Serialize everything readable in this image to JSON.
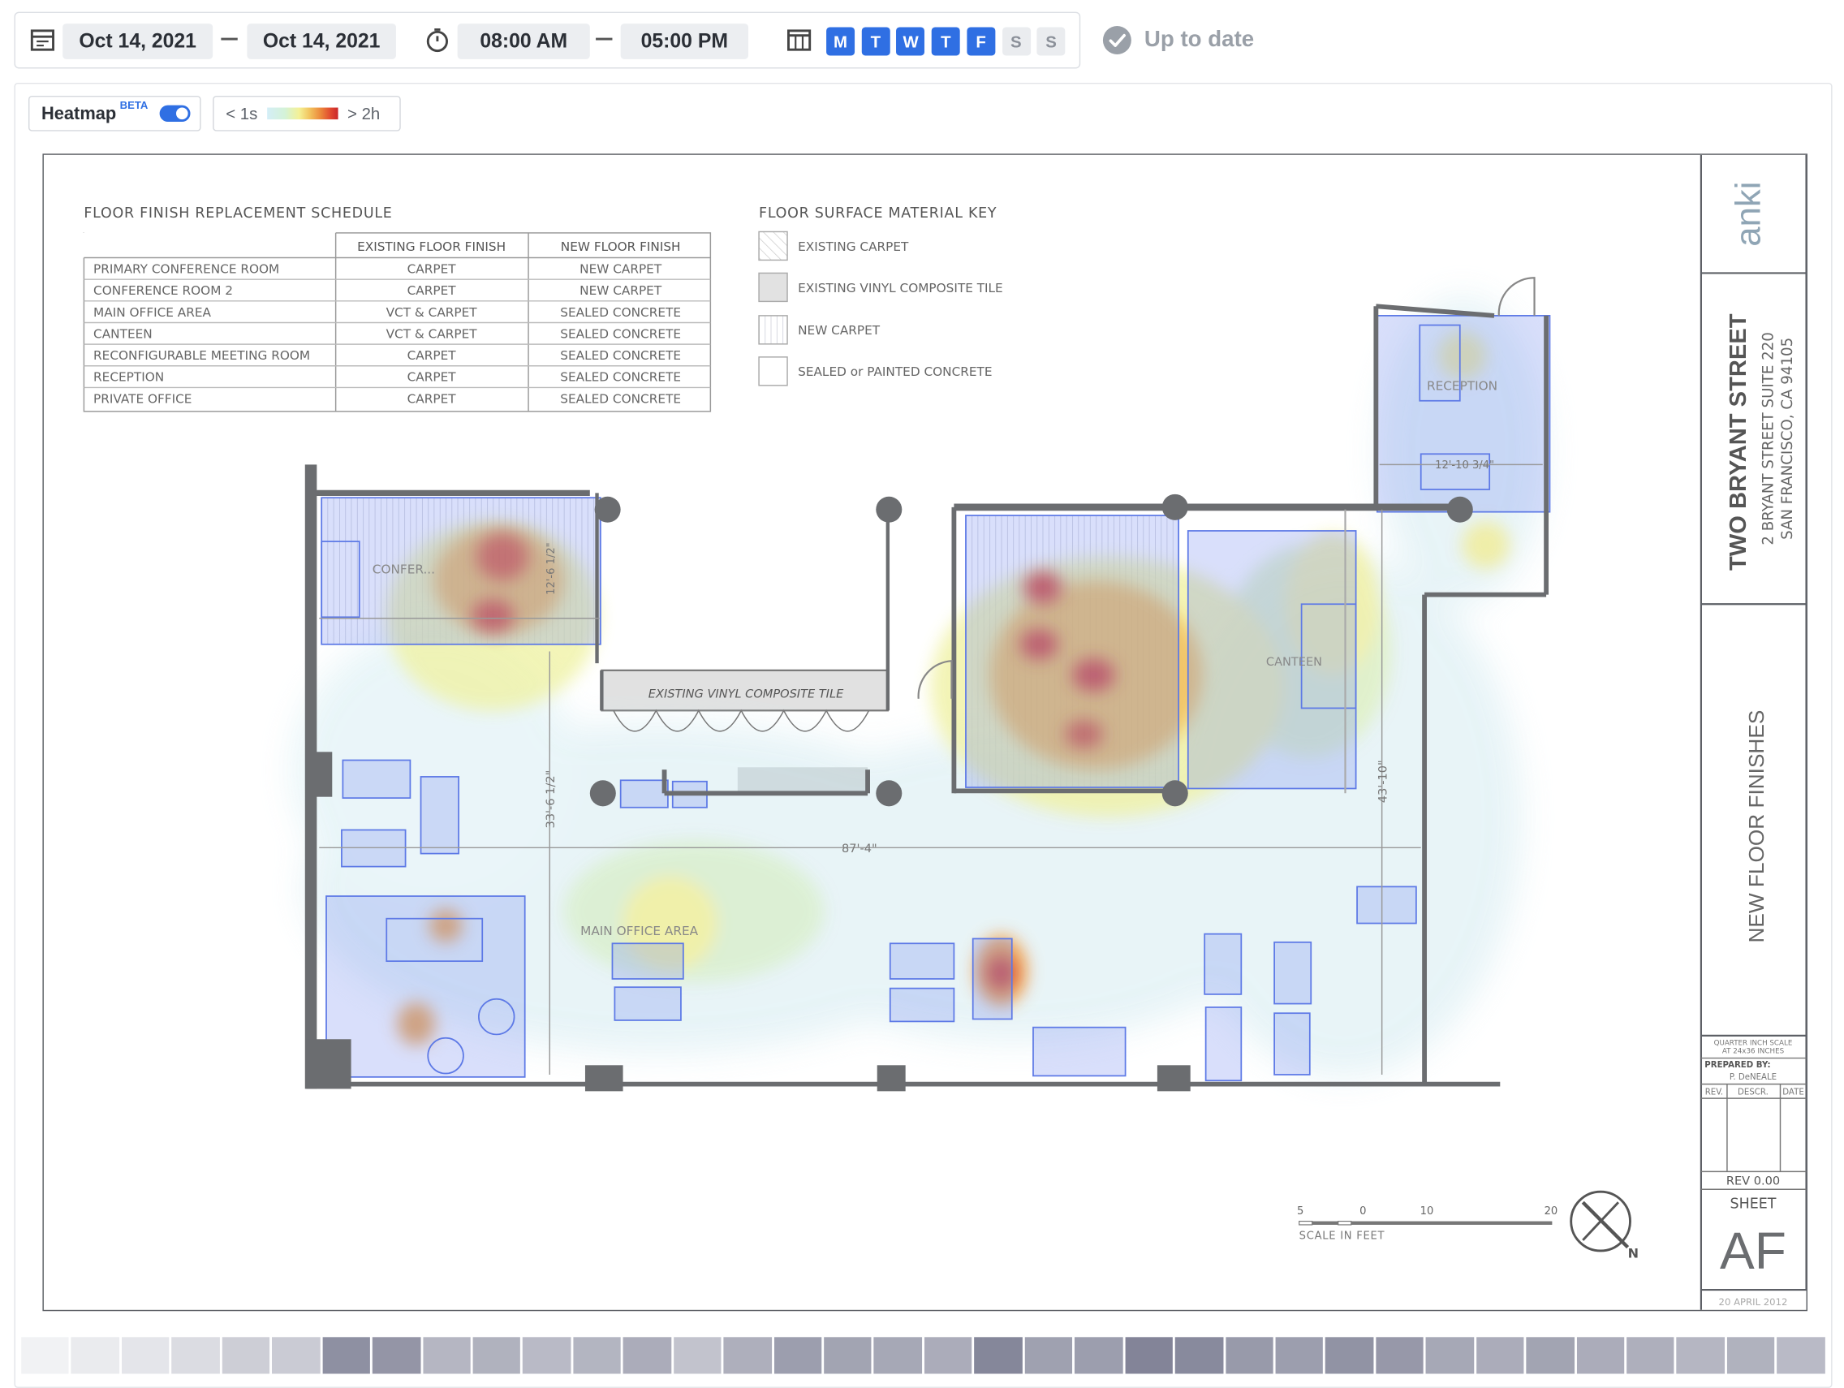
{
  "toolbar": {
    "date_start": "Oct 14, 2021",
    "date_end": "Oct 14, 2021",
    "time_start": "08:00 AM",
    "time_end": "05:00 PM",
    "days": [
      {
        "label": "M",
        "active": true
      },
      {
        "label": "T",
        "active": true
      },
      {
        "label": "W",
        "active": true
      },
      {
        "label": "T",
        "active": true
      },
      {
        "label": "F",
        "active": true
      },
      {
        "label": "S",
        "active": false
      },
      {
        "label": "S",
        "active": false
      }
    ],
    "status": "Up to date"
  },
  "heatmap_controls": {
    "label": "Heatmap",
    "badge": "BETA",
    "enabled": true,
    "legend_min": "< 1s",
    "legend_max": "> 2h"
  },
  "schedule": {
    "title": "FLOOR FINISH REPLACEMENT SCHEDULE",
    "headers": [
      "",
      "EXISTING FLOOR FINISH",
      "NEW FLOOR FINISH"
    ],
    "rows": [
      [
        "PRIMARY CONFERENCE ROOM",
        "CARPET",
        "NEW CARPET"
      ],
      [
        "CONFERENCE ROOM 2",
        "CARPET",
        "NEW CARPET"
      ],
      [
        "MAIN OFFICE AREA",
        "VCT & CARPET",
        "SEALED CONCRETE"
      ],
      [
        "CANTEEN",
        "VCT & CARPET",
        "SEALED CONCRETE"
      ],
      [
        "RECONFIGURABLE MEETING ROOM",
        "CARPET",
        "SEALED CONCRETE"
      ],
      [
        "RECEPTION",
        "CARPET",
        "SEALED CONCRETE"
      ],
      [
        "PRIVATE OFFICE",
        "CARPET",
        "SEALED CONCRETE"
      ]
    ]
  },
  "material_key": {
    "title": "FLOOR SURFACE MATERIAL KEY",
    "items": [
      "EXISTING CARPET",
      "EXISTING VINYL COMPOSITE TILE",
      "NEW CARPET",
      "SEALED or PAINTED CONCRETE"
    ]
  },
  "plan": {
    "vct_label": "EXISTING VINYL COMPOSITE TILE",
    "room_conference": "CONFER...",
    "room_main": "MAIN OFFICE AREA",
    "room_reception": "RECEPTION",
    "room_canteen": "CANTEEN",
    "dim_width": "87'-4\"",
    "dim_left": "33'-6 1/2\"",
    "dim_right": "43'-10\"",
    "dim_conf": "12'-6 1/2\"",
    "dim_reception": "12'-10 3/4\""
  },
  "scale_bar": {
    "ticks": [
      "5",
      "0",
      "10",
      "20"
    ],
    "caption": "SCALE IN FEET",
    "north": "N"
  },
  "title_block": {
    "logo": "anki",
    "street": "TWO BRYANT STREET",
    "address1": "2 BRYANT STREET  SUITE 220",
    "address2": "SAN FRANCISCO, CA  94105",
    "sheet_title": "NEW FLOOR FINISHES",
    "scale_note1": "QUARTER INCH SCALE",
    "scale_note2": "AT 24x36 INCHES",
    "prepared_label": "PREPARED BY:",
    "prepared_by": "P. DeNEALE",
    "rev_headers": [
      "REV.",
      "DESCR.",
      "DATE"
    ],
    "rev": "REV 0.00",
    "sheet_label": "SHEET",
    "sheet_code": "AF",
    "date": "20 APRIL 2012"
  },
  "timeline": {
    "levels": [
      0.03,
      0.08,
      0.12,
      0.18,
      0.28,
      0.3,
      0.72,
      0.68,
      0.45,
      0.48,
      0.42,
      0.46,
      0.52,
      0.36,
      0.5,
      0.62,
      0.58,
      0.55,
      0.52,
      0.78,
      0.6,
      0.62,
      0.8,
      0.76,
      0.65,
      0.62,
      0.7,
      0.66,
      0.55,
      0.52,
      0.58,
      0.52,
      0.5,
      0.45,
      0.48,
      0.42
    ]
  },
  "colors": {
    "accent": "#2f6fe3",
    "room_fill": "#c9d4fb",
    "room_stroke": "#5d79e6",
    "wall": "#6b6d70"
  }
}
